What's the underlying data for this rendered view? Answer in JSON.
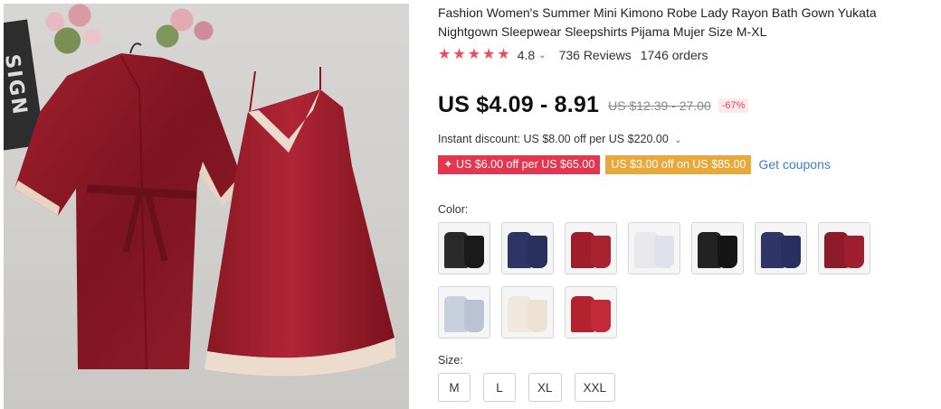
{
  "product": {
    "title": "Fashion Women's Summer Mini Kimono Robe Lady Rayon Bath Gown Yukata Nightgown Sleepwear Sleepshirts Pijama Mujer Size M-XL",
    "rating": "4.8",
    "rating_stars": 5,
    "reviews": "736 Reviews",
    "orders": "1746 orders",
    "price": "US $4.09 - 8.91",
    "old_price": "US $12.39 - 27.00",
    "discount": "-67%",
    "instant_discount": "Instant discount: US $8.00 off per US $220.00",
    "coupons": {
      "red": "✦ US $6.00 off per US $65.00",
      "orange": "US $3.00 off on US $85.00",
      "get": "Get coupons"
    },
    "color_label": "Color:",
    "size_label": "Size:",
    "sizes": [
      "M",
      "L",
      "XL",
      "XXL"
    ],
    "swatch_colors": [
      {
        "robe": "#2a2a2a",
        "dress": "#1a1a1a"
      },
      {
        "robe": "#2d3566",
        "dress": "#28305c"
      },
      {
        "robe": "#9e1e2c",
        "dress": "#a82230"
      },
      {
        "robe": "#e8e8ec",
        "dress": "#dfe2ea"
      },
      {
        "robe": "#222222",
        "dress": "#151515"
      },
      {
        "robe": "#2e3668",
        "dress": "#283061"
      },
      {
        "robe": "#8d1b2b",
        "dress": "#a01f2f"
      },
      {
        "robe": "#c8d0de",
        "dress": "#b9c3d4"
      },
      {
        "robe": "#f0e8dc",
        "dress": "#ece2d3"
      },
      {
        "robe": "#b3222e",
        "dress": "#c22a37"
      }
    ]
  },
  "colors": {
    "accent_red": "#e94c5d",
    "coupon_red": "#e5364f",
    "coupon_orange": "#e9a83a",
    "link_blue": "#3d80c6",
    "satin_red": "#8e1a26"
  },
  "image": {
    "sign_text": "SIGN"
  }
}
